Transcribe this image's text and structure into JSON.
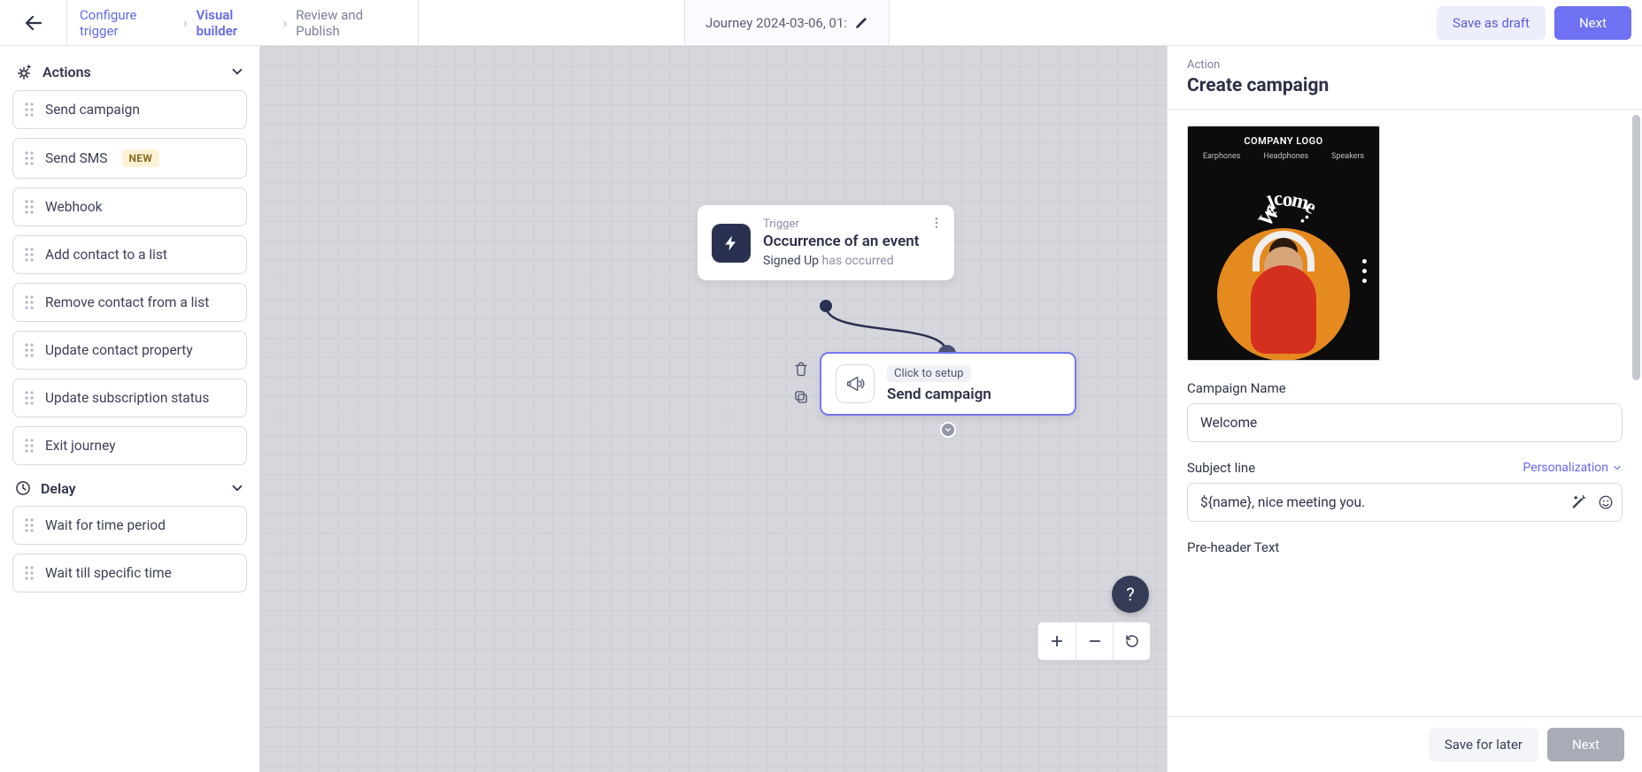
{
  "header": {
    "breadcrumbs": {
      "step1": "Configure trigger",
      "step2": "Visual builder",
      "step3": "Review and Publish"
    },
    "journey_name": "Journey 2024-03-06, 01:",
    "save_draft": "Save as draft",
    "next": "Next"
  },
  "sidebar": {
    "actions_label": "Actions",
    "delay_label": "Delay",
    "actions": [
      {
        "label": "Send campaign"
      },
      {
        "label": "Send SMS",
        "badge": "NEW"
      },
      {
        "label": "Webhook"
      },
      {
        "label": "Add contact to a list"
      },
      {
        "label": "Remove contact from a list"
      },
      {
        "label": "Update contact property"
      },
      {
        "label": "Update subscription status"
      },
      {
        "label": "Exit journey"
      }
    ],
    "delays": [
      {
        "label": "Wait for time period"
      },
      {
        "label": "Wait till specific time"
      }
    ]
  },
  "canvas": {
    "trigger": {
      "caption": "Trigger",
      "title": "Occurrence of an event",
      "detail_strong": "Signed Up",
      "detail_rest": "has occurred"
    },
    "action": {
      "setup_hint": "Click to setup",
      "title": "Send campaign"
    }
  },
  "panel": {
    "sub": "Action",
    "title": "Create campaign",
    "thumb": {
      "logo": "COMPANY LOGO",
      "tabs": [
        "Earphones",
        "Headphones",
        "Speakers"
      ],
      "arc_text": "Welcome..."
    },
    "campaign_name_label": "Campaign Name",
    "campaign_name_value": "Welcome",
    "subject_label": "Subject line",
    "personalization": "Personalization",
    "subject_value": "${name}, nice meeting you.",
    "preheader_label": "Pre-header Text",
    "save_later": "Save for later",
    "next": "Next"
  }
}
